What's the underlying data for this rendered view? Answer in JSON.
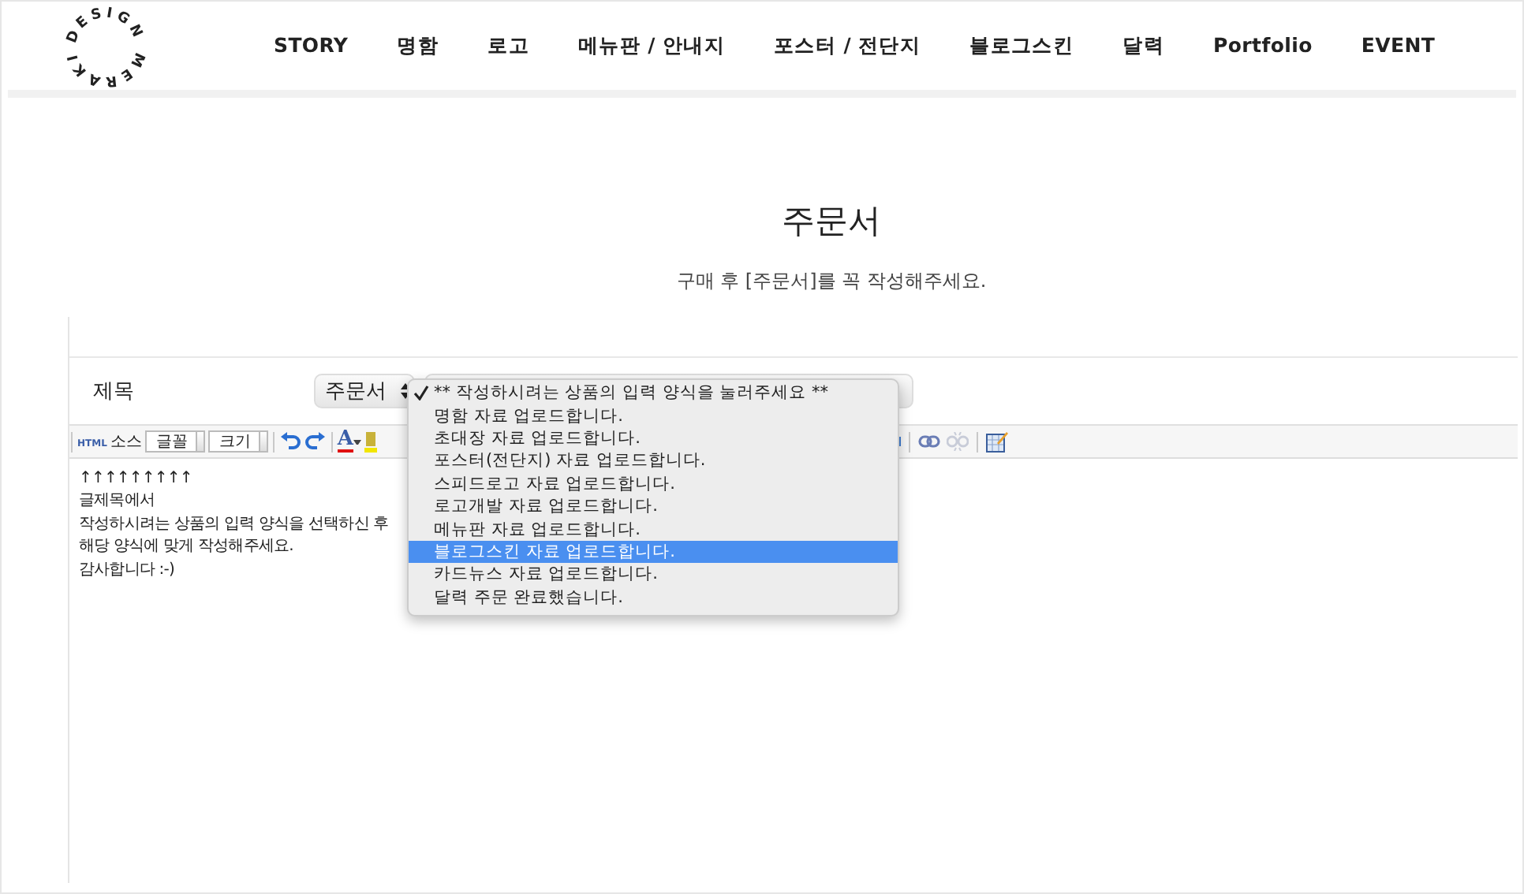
{
  "logo": "DESIGN MERAKI",
  "nav": [
    "STORY",
    "명함",
    "로고",
    "메뉴판 / 안내지",
    "포스터 / 전단지",
    "블로그스킨",
    "달력",
    "Portfolio",
    "EVENT"
  ],
  "page": {
    "title": "주문서",
    "subtitle": "구매 후 [주문서]를 꼭 작성해주세요."
  },
  "form": {
    "subject_label": "제목",
    "category_select": "주문서"
  },
  "toolbar": {
    "html_tag": "HTML",
    "source": "소스",
    "font_select": "글꼴",
    "size_select": "크기",
    "color_letter": "A"
  },
  "editor_lines": [
    "↑↑↑↑↑↑↑↑↑",
    "글제목에서",
    "작성하시려는 상품의 입력 양식을 선택하신 후",
    "해당 양식에 맞게 작성해주세요.",
    "감사합니다 :-)"
  ],
  "dropdown": [
    {
      "label": "** 작성하시려는 상품의 입력 양식을 눌러주세요 **",
      "selected": true,
      "highlighted": false
    },
    {
      "label": "명함 자료 업로드합니다.",
      "selected": false,
      "highlighted": false
    },
    {
      "label": "초대장 자료 업로드합니다.",
      "selected": false,
      "highlighted": false
    },
    {
      "label": "포스터(전단지) 자료 업로드합니다.",
      "selected": false,
      "highlighted": false
    },
    {
      "label": "스피드로고 자료 업로드합니다.",
      "selected": false,
      "highlighted": false
    },
    {
      "label": "로고개발 자료 업로드합니다.",
      "selected": false,
      "highlighted": false
    },
    {
      "label": "메뉴판 자료 업로드합니다.",
      "selected": false,
      "highlighted": false
    },
    {
      "label": "블로그스킨 자료 업로드합니다.",
      "selected": false,
      "highlighted": true
    },
    {
      "label": "카드뉴스 자료 업로드합니다.",
      "selected": false,
      "highlighted": false
    },
    {
      "label": "달력 주문 완료했습니다.",
      "selected": false,
      "highlighted": false
    }
  ]
}
